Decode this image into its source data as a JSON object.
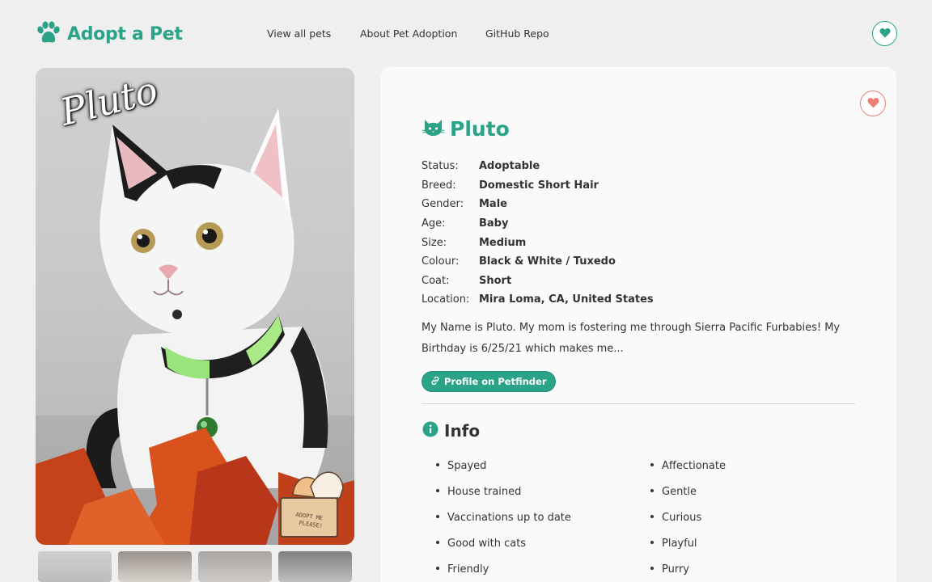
{
  "header": {
    "logo_text": "Adopt a Pet",
    "nav": [
      "View all pets",
      "About Pet Adoption",
      "GitHub Repo"
    ],
    "favorites_icon": "heart-icon"
  },
  "photo": {
    "overlay_name": "Pluto",
    "thumbnail_count": 4
  },
  "pet": {
    "name": "Pluto",
    "species_icon": "cat-icon",
    "details": [
      {
        "label": "Status:",
        "value": "Adoptable"
      },
      {
        "label": "Breed:",
        "value": "Domestic Short Hair"
      },
      {
        "label": "Gender:",
        "value": "Male"
      },
      {
        "label": "Age:",
        "value": "Baby"
      },
      {
        "label": "Size:",
        "value": "Medium"
      },
      {
        "label": "Colour:",
        "value": "Black & White / Tuxedo"
      },
      {
        "label": "Coat:",
        "value": "Short"
      },
      {
        "label": "Location:",
        "value": "Mira Loma, CA, United States"
      }
    ],
    "description": "My Name is Pluto. My mom is fostering me through Sierra Pacific Furbabies! My Birthday is 6/25/21 which makes me...",
    "profile_button": "Profile on Petfinder"
  },
  "info": {
    "title": "Info",
    "left": [
      "Spayed",
      "House trained",
      "Vaccinations up to date",
      "Good with cats",
      "Friendly"
    ],
    "right": [
      "Affectionate",
      "Gentle",
      "Curious",
      "Playful",
      "Purry"
    ]
  },
  "colors": {
    "brand": "#2aa388",
    "favorite": "#f07f77",
    "background": "#efefef",
    "card": "#fafafa"
  }
}
